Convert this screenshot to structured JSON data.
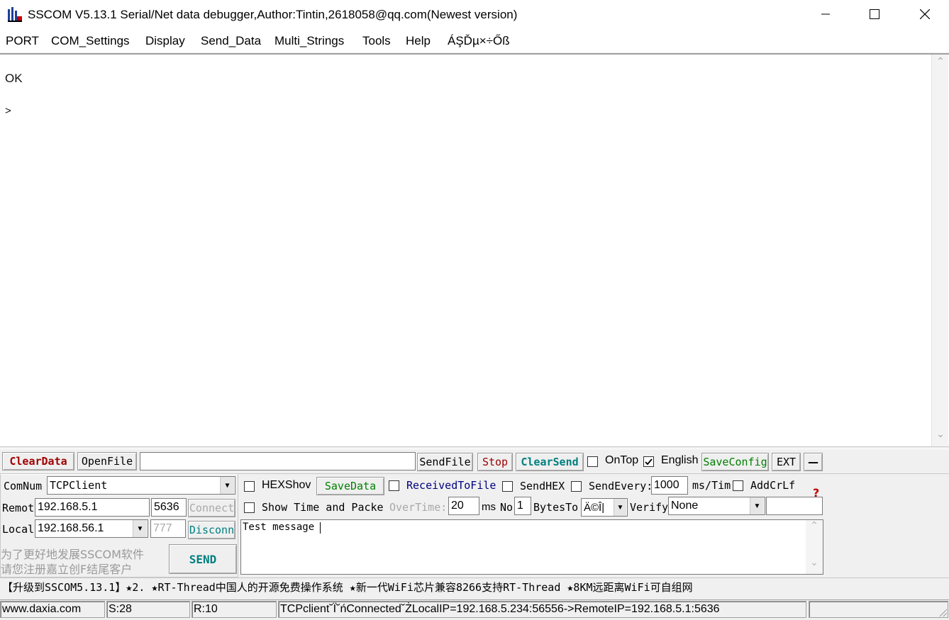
{
  "window": {
    "title": "SSCOM V5.13.1 Serial/Net data debugger,Author:Tintin,2618058@qq.com(Newest version)",
    "app_icon": "sscom-logo-icon",
    "minimize_glyph": "—",
    "maximize_glyph": "☐",
    "close_glyph": "✕"
  },
  "menu": [
    "PORT",
    "COM_Settings",
    "Display",
    "Send_Data",
    "Multi_Strings",
    "Tools",
    "Help",
    "ÁŞĎµ×÷Őß"
  ],
  "receive": {
    "lines": [
      "OK",
      ">"
    ],
    "scroll_up": "⌃",
    "scroll_down": "⌄"
  },
  "toolbar": {
    "clear_data": "ClearData",
    "open_file": "OpenFile",
    "file_path": "",
    "send_file": "SendFile",
    "stop": "Stop",
    "clear_send": "ClearSend",
    "on_top": "OnTop",
    "on_top_checked": false,
    "english": "English",
    "english_checked": true,
    "save_config": "SaveConfig",
    "ext": "EXT",
    "collapse": "—",
    "colors": {
      "clear_data": "#a00000",
      "stop": "#a00000",
      "clear_send": "#008080",
      "save_config": "#008000"
    }
  },
  "connection": {
    "comnum_label": "ComNum",
    "comnum_value": "TCPClient",
    "remote_label": "Remot",
    "remote_ip": "192.168.5.1",
    "remote_port": "5636",
    "connect": "Connect",
    "local_label": "Local",
    "local_ip": "192.168.56.1",
    "local_port": "777",
    "disconnect": "Disconn",
    "promo_line1": "为了更好地发展SSCOM软件",
    "promo_line2": "请您注册嘉立创F结尾客户",
    "send": "SEND"
  },
  "options": {
    "hexshow": "HEXShov",
    "save_data": "SaveData",
    "received_to_file": "ReceivedToFile",
    "send_hex": "SendHEX",
    "send_every": "SendEvery:",
    "send_every_value": "1000",
    "ms_tim": "ms/Tim",
    "add_crlf": "AddCrLf",
    "help_icon": "?",
    "show_time": "Show Time and Packe",
    "overtime": "OverTime:",
    "overtime_value": "20",
    "ms": "ms",
    "no": "No",
    "no_value": "1",
    "bytes_to": "BytesTo",
    "bytes_to_value": "Ä©Î|",
    "verify": "Verify",
    "verify_value": "None",
    "verify_extra": ""
  },
  "send_text": "Test message",
  "ticker": "【升级到SSCOM5.13.1】★2. ★RT-Thread中国人的开源免费操作系统 ★新一代WiFi芯片兼容8266支持RT-Thread ★8KM远距离WiFi可自组网",
  "status": {
    "website": "www.daxia.com",
    "sent": "S:28",
    "received": "R:10",
    "message": "TCPclient˘Ϊ˘ńConnected˘ŻLocalIP=192.168.5.234:56556->RemoteIP=192.168.5.1:5636",
    "extra": ""
  }
}
